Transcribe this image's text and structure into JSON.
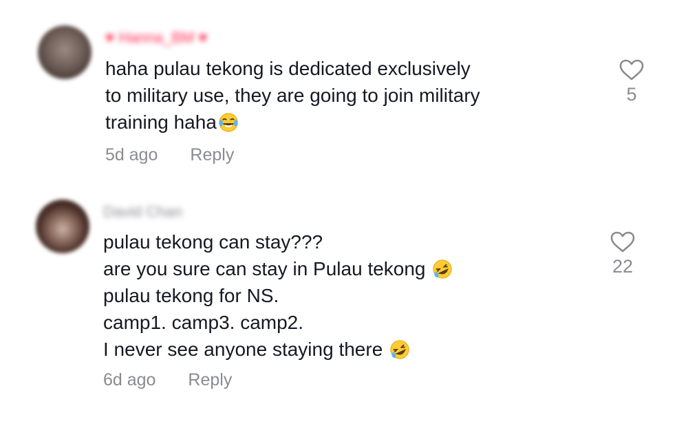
{
  "comments": [
    {
      "username": "Hanna_BM",
      "lines": [
        "haha pulau tekong is dedicated exclusively",
        "to military use, they are going to join military",
        "training haha"
      ],
      "emoji_after_last_line": "laughing-tears-icon",
      "time": "5d ago",
      "reply_label": "Reply",
      "likes": "5"
    },
    {
      "username": "David Chan",
      "lines": [
        "pulau tekong can stay???",
        "are you sure can stay in Pulau tekong",
        "pulau tekong for NS.",
        "camp1. camp3. camp2.",
        "I never see anyone staying there"
      ],
      "emoji_lines": [
        "rofl-icon",
        "rofl-icon"
      ],
      "time": "6d ago",
      "reply_label": "Reply",
      "likes": "22"
    }
  ],
  "colors": {
    "text": "#161823",
    "secondary": "#8a8b91",
    "username_highlight": "#fe2c55"
  }
}
